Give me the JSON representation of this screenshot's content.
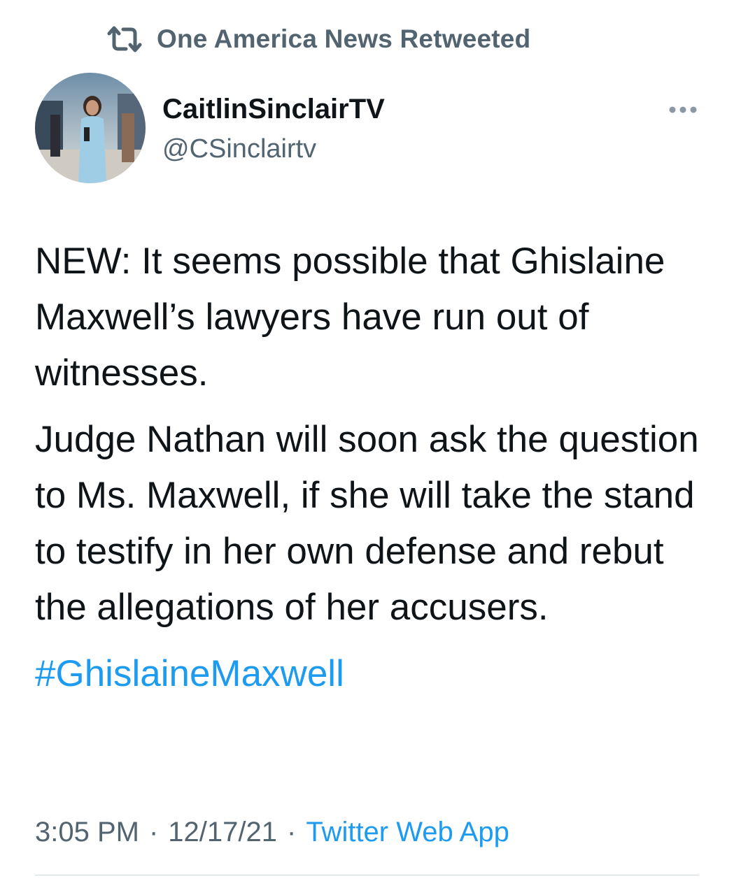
{
  "retweet_banner": {
    "icon": "retweet-icon",
    "text": "One America News Retweeted"
  },
  "author": {
    "display_name": "CaitlinSinclairTV",
    "handle": "@CSinclairtv",
    "avatar_icon": "profile-photo"
  },
  "more_menu_icon": "more-options-icon",
  "tweet": {
    "paragraphs": [
      "NEW: It seems possible that Ghislaine Maxwell’s lawyers have run out of witnesses.",
      "Judge Nathan will soon ask the question to Ms. Maxwell, if she will take the stand to testify in her own defense and rebut the allegations of her accusers."
    ],
    "hashtag": "#GhislaineMaxwell"
  },
  "meta": {
    "time": "3:05 PM",
    "separator": "·",
    "date": "12/17/21",
    "source": "Twitter Web App"
  },
  "colors": {
    "text": "#0f1419",
    "secondary": "#536471",
    "link": "#1d9bf0",
    "divider": "#cfd9de"
  }
}
